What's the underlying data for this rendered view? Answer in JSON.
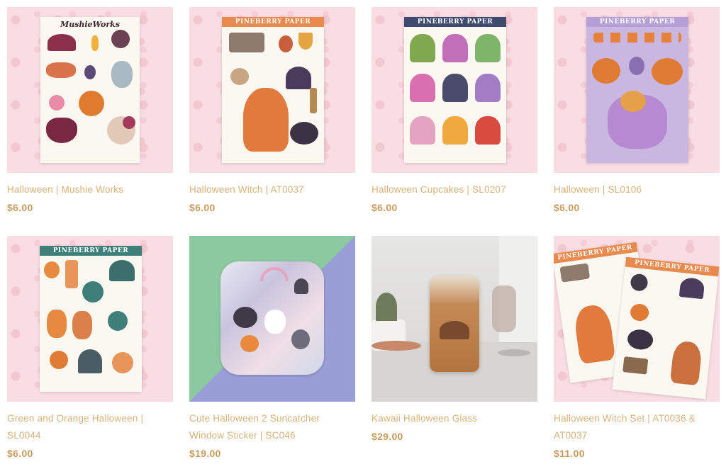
{
  "colors": {
    "title": "#d7b37c",
    "price": "#c69c60",
    "thumb_bg": "#f9dde2"
  },
  "products": [
    {
      "title": "Halloween | Mushie Works",
      "price": "$6.00",
      "sheet_brand": "MushieWorks"
    },
    {
      "title": "Halloween Witch | AT0037",
      "price": "$6.00",
      "sheet_brand": "PINEBERRY PAPER"
    },
    {
      "title": "Halloween Cupcakes | SL0207",
      "price": "$6.00",
      "sheet_brand": "PINEBERRY PAPER"
    },
    {
      "title": "Halloween | SL0106",
      "price": "$6.00",
      "sheet_brand": "PINEBERRY PAPER"
    },
    {
      "title": "Green and Orange Halloween | SL0044",
      "price": "$6.00",
      "sheet_brand": "PINEBERRY PAPER"
    },
    {
      "title": "Cute Halloween 2 Suncatcher Window Sticker | SC046",
      "price": "$19.00"
    },
    {
      "title": "Kawaii Halloween Glass",
      "price": "$29.00"
    },
    {
      "title": "Halloween Witch Set | AT0036 & AT0037",
      "price": "$11.00",
      "sheet_brand": "PINEBERRY PAPER"
    }
  ]
}
